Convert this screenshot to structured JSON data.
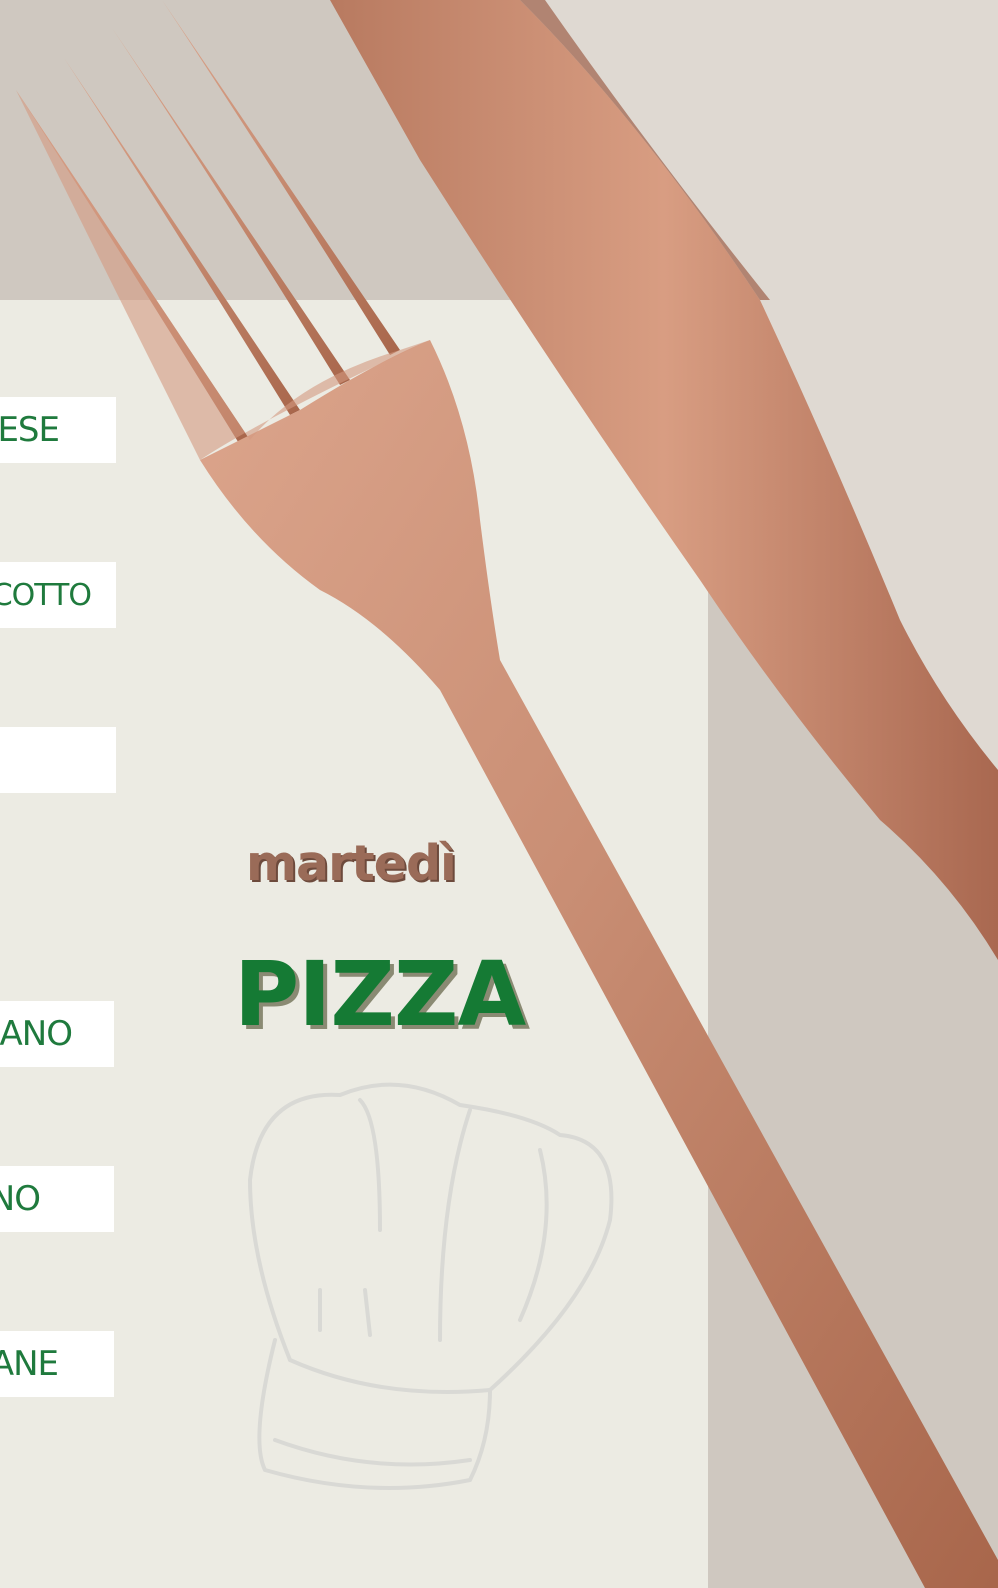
{
  "menu": {
    "day": "martedì",
    "title": "PIZZA",
    "items": [
      "ESE",
      "COTTO",
      "",
      "ANO",
      "NO",
      "ANE"
    ]
  },
  "colors": {
    "background": "#cfc8c0",
    "paper": "#ecebe3",
    "cutlery": "#c98e74",
    "green_text": "#1f7a3d",
    "day_text": "#9a6b58"
  },
  "icons": [
    "fork-icon",
    "knife-icon",
    "chef-hat-icon"
  ]
}
